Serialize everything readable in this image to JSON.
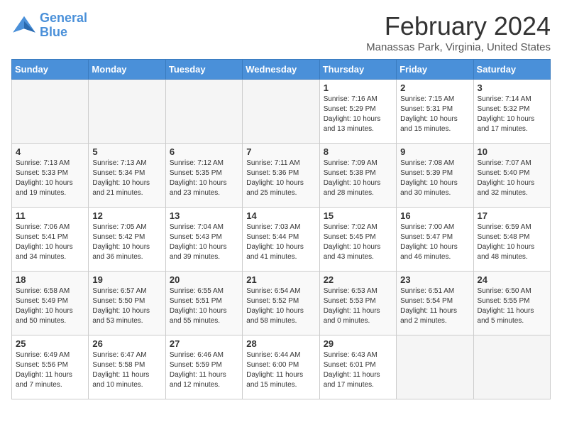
{
  "logo": {
    "line1": "General",
    "line2": "Blue"
  },
  "title": "February 2024",
  "location": "Manassas Park, Virginia, United States",
  "days_header": [
    "Sunday",
    "Monday",
    "Tuesday",
    "Wednesday",
    "Thursday",
    "Friday",
    "Saturday"
  ],
  "weeks": [
    [
      {
        "day": "",
        "info": ""
      },
      {
        "day": "",
        "info": ""
      },
      {
        "day": "",
        "info": ""
      },
      {
        "day": "",
        "info": ""
      },
      {
        "day": "1",
        "info": "Sunrise: 7:16 AM\nSunset: 5:29 PM\nDaylight: 10 hours\nand 13 minutes."
      },
      {
        "day": "2",
        "info": "Sunrise: 7:15 AM\nSunset: 5:31 PM\nDaylight: 10 hours\nand 15 minutes."
      },
      {
        "day": "3",
        "info": "Sunrise: 7:14 AM\nSunset: 5:32 PM\nDaylight: 10 hours\nand 17 minutes."
      }
    ],
    [
      {
        "day": "4",
        "info": "Sunrise: 7:13 AM\nSunset: 5:33 PM\nDaylight: 10 hours\nand 19 minutes."
      },
      {
        "day": "5",
        "info": "Sunrise: 7:13 AM\nSunset: 5:34 PM\nDaylight: 10 hours\nand 21 minutes."
      },
      {
        "day": "6",
        "info": "Sunrise: 7:12 AM\nSunset: 5:35 PM\nDaylight: 10 hours\nand 23 minutes."
      },
      {
        "day": "7",
        "info": "Sunrise: 7:11 AM\nSunset: 5:36 PM\nDaylight: 10 hours\nand 25 minutes."
      },
      {
        "day": "8",
        "info": "Sunrise: 7:09 AM\nSunset: 5:38 PM\nDaylight: 10 hours\nand 28 minutes."
      },
      {
        "day": "9",
        "info": "Sunrise: 7:08 AM\nSunset: 5:39 PM\nDaylight: 10 hours\nand 30 minutes."
      },
      {
        "day": "10",
        "info": "Sunrise: 7:07 AM\nSunset: 5:40 PM\nDaylight: 10 hours\nand 32 minutes."
      }
    ],
    [
      {
        "day": "11",
        "info": "Sunrise: 7:06 AM\nSunset: 5:41 PM\nDaylight: 10 hours\nand 34 minutes."
      },
      {
        "day": "12",
        "info": "Sunrise: 7:05 AM\nSunset: 5:42 PM\nDaylight: 10 hours\nand 36 minutes."
      },
      {
        "day": "13",
        "info": "Sunrise: 7:04 AM\nSunset: 5:43 PM\nDaylight: 10 hours\nand 39 minutes."
      },
      {
        "day": "14",
        "info": "Sunrise: 7:03 AM\nSunset: 5:44 PM\nDaylight: 10 hours\nand 41 minutes."
      },
      {
        "day": "15",
        "info": "Sunrise: 7:02 AM\nSunset: 5:45 PM\nDaylight: 10 hours\nand 43 minutes."
      },
      {
        "day": "16",
        "info": "Sunrise: 7:00 AM\nSunset: 5:47 PM\nDaylight: 10 hours\nand 46 minutes."
      },
      {
        "day": "17",
        "info": "Sunrise: 6:59 AM\nSunset: 5:48 PM\nDaylight: 10 hours\nand 48 minutes."
      }
    ],
    [
      {
        "day": "18",
        "info": "Sunrise: 6:58 AM\nSunset: 5:49 PM\nDaylight: 10 hours\nand 50 minutes."
      },
      {
        "day": "19",
        "info": "Sunrise: 6:57 AM\nSunset: 5:50 PM\nDaylight: 10 hours\nand 53 minutes."
      },
      {
        "day": "20",
        "info": "Sunrise: 6:55 AM\nSunset: 5:51 PM\nDaylight: 10 hours\nand 55 minutes."
      },
      {
        "day": "21",
        "info": "Sunrise: 6:54 AM\nSunset: 5:52 PM\nDaylight: 10 hours\nand 58 minutes."
      },
      {
        "day": "22",
        "info": "Sunrise: 6:53 AM\nSunset: 5:53 PM\nDaylight: 11 hours\nand 0 minutes."
      },
      {
        "day": "23",
        "info": "Sunrise: 6:51 AM\nSunset: 5:54 PM\nDaylight: 11 hours\nand 2 minutes."
      },
      {
        "day": "24",
        "info": "Sunrise: 6:50 AM\nSunset: 5:55 PM\nDaylight: 11 hours\nand 5 minutes."
      }
    ],
    [
      {
        "day": "25",
        "info": "Sunrise: 6:49 AM\nSunset: 5:56 PM\nDaylight: 11 hours\nand 7 minutes."
      },
      {
        "day": "26",
        "info": "Sunrise: 6:47 AM\nSunset: 5:58 PM\nDaylight: 11 hours\nand 10 minutes."
      },
      {
        "day": "27",
        "info": "Sunrise: 6:46 AM\nSunset: 5:59 PM\nDaylight: 11 hours\nand 12 minutes."
      },
      {
        "day": "28",
        "info": "Sunrise: 6:44 AM\nSunset: 6:00 PM\nDaylight: 11 hours\nand 15 minutes."
      },
      {
        "day": "29",
        "info": "Sunrise: 6:43 AM\nSunset: 6:01 PM\nDaylight: 11 hours\nand 17 minutes."
      },
      {
        "day": "",
        "info": ""
      },
      {
        "day": "",
        "info": ""
      }
    ]
  ]
}
